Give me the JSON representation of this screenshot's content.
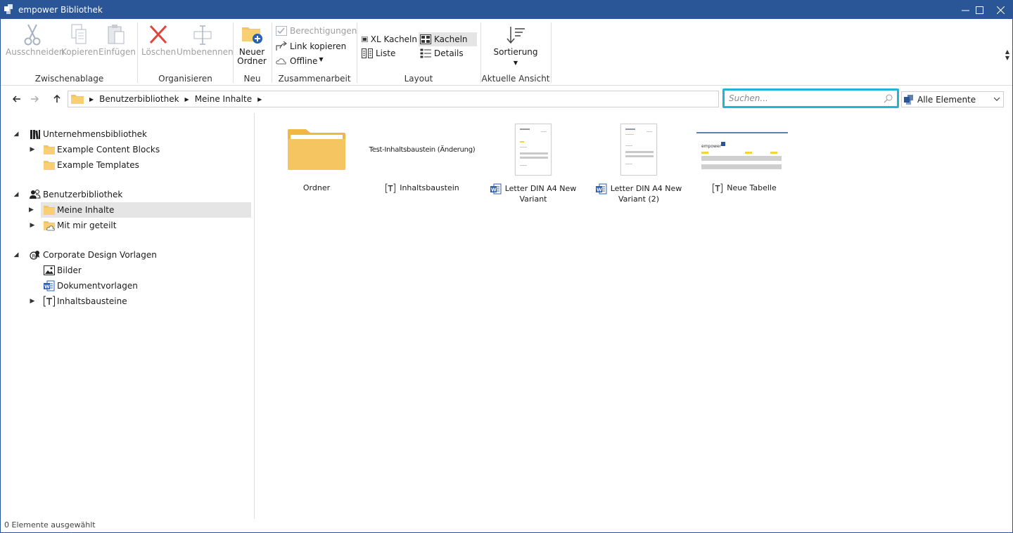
{
  "window": {
    "title": "empower Bibliothek",
    "controls": [
      "minimize-icon",
      "maximize-icon",
      "close-icon"
    ]
  },
  "ribbon": {
    "groups": {
      "clipboard": "Zwischenablage",
      "organize": "Organisieren",
      "new": "Neu",
      "collab": "Zusammenarbeit",
      "layout": "Layout",
      "view": "Aktuelle Ansicht"
    },
    "cut": "Ausschneiden",
    "copy": "Kopieren",
    "paste": "Einfügen",
    "delete": "Löschen",
    "rename": "Umbenennen",
    "new_folder_1": "Neuer",
    "new_folder_2": "Ordner",
    "permissions": "Berechtigungen",
    "copy_link": "Link kopieren",
    "offline": "Offline",
    "xl_tiles": "XL Kacheln",
    "tiles": "Kacheln",
    "list": "Liste",
    "details": "Details",
    "sort": "Sortierung",
    "selected_layout": "Kacheln"
  },
  "address": {
    "crumbs": [
      "Benutzerbibliothek",
      "Meine Inhalte"
    ],
    "search_placeholder": "Suchen...",
    "filter_value": "Alle Elemente"
  },
  "tree": {
    "company_library": "Unternehmensbibliothek",
    "example_blocks": "Example Content Blocks",
    "example_templates": "Example Templates",
    "user_library": "Benutzerbibliothek",
    "my_content": "Meine Inhalte",
    "shared_with_me": "Mit mir geteilt",
    "cd_templates": "Corporate Design Vorlagen",
    "images": "Bilder",
    "doc_templates": "Dokumentvorlagen",
    "content_blocks": "Inhaltsbausteine",
    "selected": "Meine Inhalte"
  },
  "items": [
    {
      "name": "Ordner",
      "type": "folder"
    },
    {
      "name": "Inhaltsbaustein",
      "preview": "Test-Inhaltsbaustein (Änderung)",
      "type": "content-block"
    },
    {
      "name": "Letter DIN A4 New Variant",
      "type": "word"
    },
    {
      "name": "Letter DIN A4 New Variant (2)",
      "type": "word"
    },
    {
      "name": "Neue Tabelle",
      "type": "content-block",
      "preview": "empower"
    }
  ],
  "status": "0 Elemente ausgewählt",
  "colors": {
    "titlebar": "#2a5597",
    "search_focus": "#1fb4d8",
    "folder": "#f5c562",
    "selection": "#e5e5e5",
    "delete_red": "#e0443e",
    "word_blue": "#2b5fb3"
  }
}
